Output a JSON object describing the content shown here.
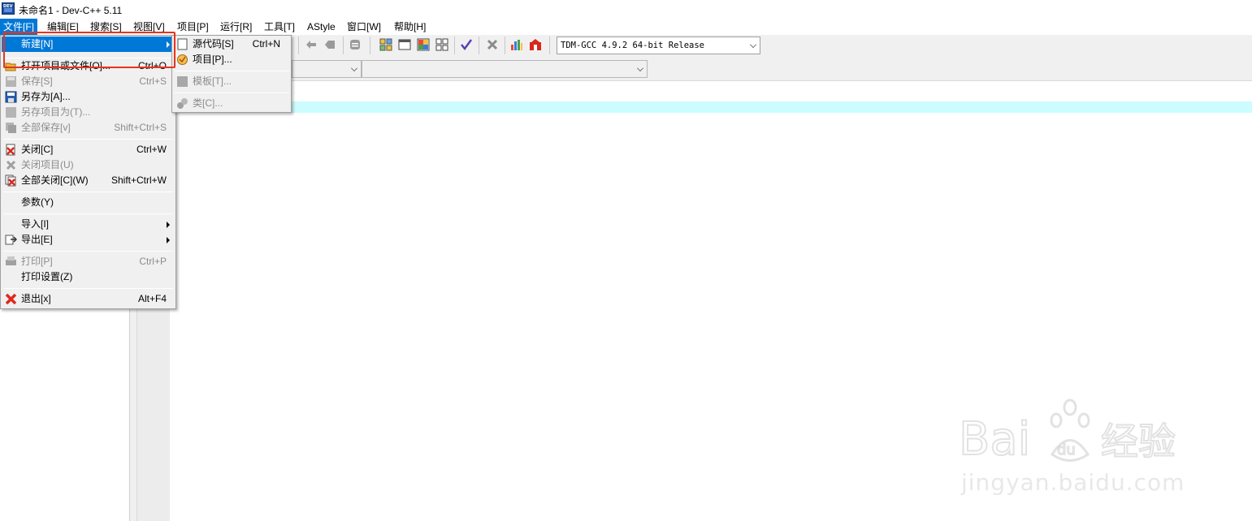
{
  "window": {
    "title": "未命名1 - Dev-C++ 5.11",
    "icon": "dev-cpp-app-icon"
  },
  "menubar": {
    "items": [
      {
        "label": "文件[F]",
        "active": true
      },
      {
        "label": "编辑[E]"
      },
      {
        "label": "搜索[S]"
      },
      {
        "label": "视图[V]"
      },
      {
        "label": "项目[P]"
      },
      {
        "label": "运行[R]"
      },
      {
        "label": "工具[T]"
      },
      {
        "label": "AStyle"
      },
      {
        "label": "窗口[W]"
      },
      {
        "label": "帮助[H]"
      }
    ]
  },
  "toolbar": {
    "compiler_select": "TDM-GCC 4.9.2 64-bit Release",
    "icons": [
      "back-icon",
      "forward-icon",
      "indent-icon",
      "tile-grid-icon",
      "window-icon",
      "color-palette-icon",
      "small-grid-icon",
      "check-syntax-icon",
      "delete-icon",
      "chart-icon",
      "profile-icon"
    ]
  },
  "file_menu": {
    "items": [
      {
        "label": "新建[N]",
        "shortcut": "",
        "submenu": true,
        "highlighted": true
      },
      {
        "label": "打开项目或文件[O]...",
        "shortcut": "Ctrl+O",
        "icon": "open-folder-icon"
      },
      {
        "label": "保存[S]",
        "shortcut": "Ctrl+S",
        "disabled": true,
        "icon": "save-icon"
      },
      {
        "label": "另存为[A]...",
        "shortcut": "",
        "icon": "save-as-icon"
      },
      {
        "label": "另存项目为(T)...",
        "shortcut": "",
        "disabled": true,
        "icon": "save-project-icon"
      },
      {
        "label": "全部保存[v]",
        "shortcut": "Shift+Ctrl+S",
        "disabled": true,
        "icon": "save-all-icon"
      },
      {
        "label": "关闭[C]",
        "shortcut": "Ctrl+W",
        "icon": "close-file-icon"
      },
      {
        "label": "关闭项目(U)",
        "shortcut": "",
        "disabled": true,
        "icon": "close-project-icon"
      },
      {
        "label": "全部关闭[C](W)",
        "shortcut": "Shift+Ctrl+W",
        "icon": "close-all-icon"
      },
      {
        "label": "参数(Y)",
        "shortcut": ""
      },
      {
        "label": "导入[I]",
        "shortcut": "",
        "submenu": true
      },
      {
        "label": "导出[E]",
        "shortcut": "",
        "submenu": true,
        "icon": "export-icon"
      },
      {
        "label": "打印[P]",
        "shortcut": "Ctrl+P",
        "disabled": true,
        "icon": "print-icon"
      },
      {
        "label": "打印设置(Z)",
        "shortcut": ""
      },
      {
        "label": "退出[x]",
        "shortcut": "Alt+F4",
        "icon": "exit-icon"
      }
    ]
  },
  "new_submenu": {
    "items": [
      {
        "label": "源代码[S]",
        "shortcut": "Ctrl+N",
        "icon": "source-file-icon"
      },
      {
        "label": "项目[P]...",
        "shortcut": "",
        "icon": "project-icon"
      },
      {
        "label": "模板[T]...",
        "shortcut": "",
        "disabled": true,
        "icon": "template-icon"
      },
      {
        "label": "类[C]...",
        "shortcut": "",
        "disabled": true,
        "icon": "class-icon"
      }
    ]
  },
  "watermark": {
    "text": "jingyan.baidu.com",
    "logo_text": "Baidu 经验"
  },
  "colors": {
    "highlight": "#0078d7",
    "current_line": "#ccfcfe",
    "annotation": "#e8331e"
  }
}
